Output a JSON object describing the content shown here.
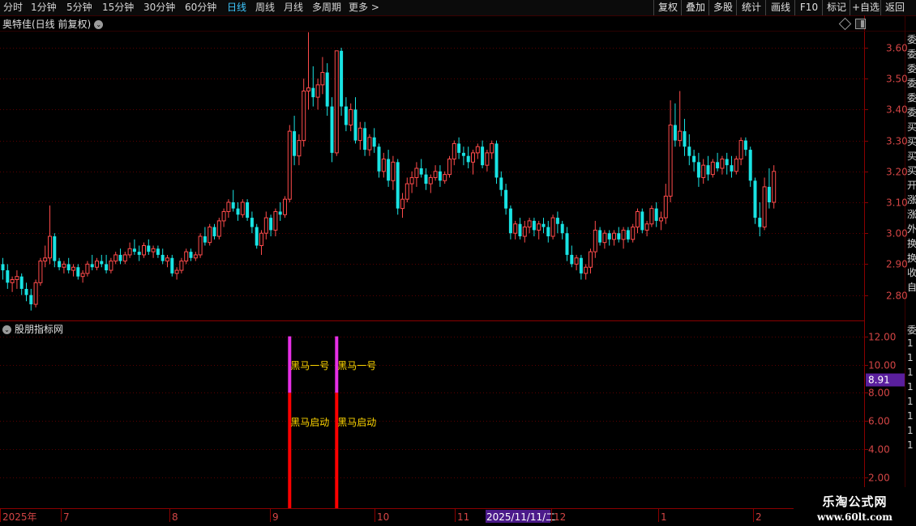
{
  "toolbar": {
    "periods": [
      "分时",
      "1分钟",
      "5分钟",
      "15分钟",
      "30分钟",
      "60分钟",
      "日线",
      "周线",
      "月线",
      "多周期",
      "更多 >"
    ],
    "active_period": "日线",
    "actions": [
      "复权",
      "叠加",
      "多股",
      "统计",
      "画线",
      "F10",
      "标记",
      "+自选",
      "返回"
    ]
  },
  "main_chart": {
    "title": "奥特佳(日线 前复权)",
    "y_ticks": [
      "3.60",
      "3.50",
      "3.40",
      "3.30",
      "3.20",
      "3.10",
      "3.00",
      "2.90",
      "2.80"
    ]
  },
  "indicator": {
    "title": "股朋指标网",
    "y_ticks": [
      "12.00",
      "10.00",
      "8.00",
      "6.00",
      "4.00",
      "2.00"
    ],
    "current_value": "8.91",
    "signal_top_label": "黑马一号",
    "signal_bottom_label": "黑马启动"
  },
  "x_axis": {
    "labels": [
      "2025年",
      "7",
      "8",
      "9",
      "10",
      "11",
      "2025/11/11/二",
      "12",
      "1",
      "2"
    ]
  },
  "watermark": {
    "title": "乐淘公式网",
    "url": "www.60lt.com"
  },
  "right_strip": [
    "委",
    "委",
    "委",
    "委",
    "委",
    "委",
    "买",
    "买",
    "买",
    "买",
    "开",
    "涨",
    "涨",
    "外",
    "换",
    "换",
    "收",
    "自",
    "委",
    "1",
    "1",
    "1",
    "1",
    "1",
    "1",
    "1",
    "1"
  ],
  "colors": {
    "up": "#ff4b4b",
    "down": "#19e3e3",
    "axis_red": "#8a0000",
    "magenta": "#e62fe6",
    "signal_red": "#ff0000",
    "label_yellow": "#ffd700",
    "value_bg": "#5a1f9e",
    "x_highlight_bg": "#4b1a8a"
  },
  "chart_data": {
    "type": "candlestick",
    "ylim": [
      2.73,
      3.68
    ],
    "candles": [
      [
        2.9,
        2.92,
        2.85,
        2.88
      ],
      [
        2.88,
        2.9,
        2.82,
        2.84
      ],
      [
        2.84,
        2.86,
        2.81,
        2.85
      ],
      [
        2.85,
        2.88,
        2.82,
        2.86
      ],
      [
        2.86,
        2.87,
        2.8,
        2.82
      ],
      [
        2.82,
        2.84,
        2.78,
        2.8
      ],
      [
        2.8,
        2.82,
        2.75,
        2.77
      ],
      [
        2.77,
        2.85,
        2.76,
        2.84
      ],
      [
        2.84,
        2.92,
        2.83,
        2.91
      ],
      [
        2.91,
        2.96,
        2.89,
        2.92
      ],
      [
        2.92,
        3.09,
        2.9,
        2.99
      ],
      [
        2.99,
        3.0,
        2.89,
        2.91
      ],
      [
        2.91,
        2.92,
        2.88,
        2.89
      ],
      [
        2.89,
        2.91,
        2.87,
        2.9
      ],
      [
        2.9,
        2.92,
        2.87,
        2.88
      ],
      [
        2.88,
        2.9,
        2.86,
        2.89
      ],
      [
        2.89,
        2.9,
        2.85,
        2.86
      ],
      [
        2.86,
        2.88,
        2.84,
        2.87
      ],
      [
        2.87,
        2.91,
        2.86,
        2.9
      ],
      [
        2.9,
        2.93,
        2.88,
        2.89
      ],
      [
        2.89,
        2.92,
        2.88,
        2.91
      ],
      [
        2.91,
        2.93,
        2.89,
        2.9
      ],
      [
        2.9,
        2.93,
        2.87,
        2.88
      ],
      [
        2.88,
        2.92,
        2.87,
        2.91
      ],
      [
        2.91,
        2.94,
        2.9,
        2.93
      ],
      [
        2.93,
        2.95,
        2.9,
        2.91
      ],
      [
        2.91,
        2.94,
        2.9,
        2.93
      ],
      [
        2.93,
        2.97,
        2.92,
        2.95
      ],
      [
        2.95,
        2.98,
        2.93,
        2.94
      ],
      [
        2.94,
        2.96,
        2.91,
        2.93
      ],
      [
        2.93,
        2.97,
        2.92,
        2.96
      ],
      [
        2.96,
        2.98,
        2.93,
        2.94
      ],
      [
        2.94,
        2.96,
        2.92,
        2.95
      ],
      [
        2.95,
        2.96,
        2.92,
        2.93
      ],
      [
        2.93,
        2.95,
        2.9,
        2.91
      ],
      [
        2.91,
        2.93,
        2.89,
        2.92
      ],
      [
        2.92,
        2.93,
        2.86,
        2.87
      ],
      [
        2.87,
        2.89,
        2.85,
        2.88
      ],
      [
        2.88,
        2.92,
        2.87,
        2.91
      ],
      [
        2.91,
        2.95,
        2.9,
        2.94
      ],
      [
        2.94,
        2.95,
        2.91,
        2.92
      ],
      [
        2.92,
        2.94,
        2.91,
        2.93
      ],
      [
        2.93,
        3.0,
        2.92,
        2.99
      ],
      [
        2.99,
        3.02,
        2.96,
        2.97
      ],
      [
        2.97,
        3.03,
        2.96,
        3.02
      ],
      [
        3.02,
        3.03,
        2.98,
        2.99
      ],
      [
        2.99,
        3.05,
        2.98,
        3.04
      ],
      [
        3.04,
        3.08,
        3.02,
        3.07
      ],
      [
        3.07,
        3.11,
        3.05,
        3.1
      ],
      [
        3.1,
        3.14,
        3.07,
        3.08
      ],
      [
        3.08,
        3.1,
        3.04,
        3.06
      ],
      [
        3.06,
        3.11,
        3.05,
        3.1
      ],
      [
        3.1,
        3.11,
        3.04,
        3.05
      ],
      [
        3.05,
        3.07,
        3.0,
        3.02
      ],
      [
        3.02,
        3.03,
        2.95,
        2.96
      ],
      [
        2.96,
        3.01,
        2.93,
        3.0
      ],
      [
        3.0,
        3.07,
        2.98,
        3.05
      ],
      [
        3.05,
        3.06,
        2.99,
        3.01
      ],
      [
        3.01,
        3.08,
        2.99,
        3.07
      ],
      [
        3.07,
        3.1,
        3.04,
        3.06
      ],
      [
        3.06,
        3.12,
        3.05,
        3.11
      ],
      [
        3.11,
        3.35,
        3.1,
        3.33
      ],
      [
        3.33,
        3.38,
        3.22,
        3.25
      ],
      [
        3.25,
        3.32,
        3.22,
        3.3
      ],
      [
        3.3,
        3.5,
        3.28,
        3.46
      ],
      [
        3.46,
        3.65,
        3.4,
        3.47
      ],
      [
        3.47,
        3.54,
        3.41,
        3.44
      ],
      [
        3.44,
        3.5,
        3.4,
        3.48
      ],
      [
        3.48,
        3.57,
        3.45,
        3.52
      ],
      [
        3.52,
        3.55,
        3.38,
        3.41
      ],
      [
        3.41,
        3.44,
        3.23,
        3.26
      ],
      [
        3.26,
        3.59,
        3.25,
        3.59
      ],
      [
        3.59,
        3.6,
        3.38,
        3.41
      ],
      [
        3.41,
        3.44,
        3.33,
        3.35
      ],
      [
        3.35,
        3.42,
        3.33,
        3.4
      ],
      [
        3.4,
        3.44,
        3.29,
        3.3
      ],
      [
        3.3,
        3.36,
        3.27,
        3.34
      ],
      [
        3.34,
        3.36,
        3.25,
        3.27
      ],
      [
        3.27,
        3.32,
        3.25,
        3.31
      ],
      [
        3.31,
        3.34,
        3.26,
        3.28
      ],
      [
        3.28,
        3.29,
        3.18,
        3.2
      ],
      [
        3.2,
        3.26,
        3.18,
        3.24
      ],
      [
        3.24,
        3.27,
        3.15,
        3.17
      ],
      [
        3.17,
        3.25,
        3.14,
        3.23
      ],
      [
        3.23,
        3.24,
        3.06,
        3.08
      ],
      [
        3.08,
        3.13,
        3.05,
        3.11
      ],
      [
        3.11,
        3.18,
        3.1,
        3.16
      ],
      [
        3.16,
        3.2,
        3.13,
        3.18
      ],
      [
        3.18,
        3.23,
        3.15,
        3.21
      ],
      [
        3.21,
        3.24,
        3.18,
        3.19
      ],
      [
        3.19,
        3.21,
        3.14,
        3.16
      ],
      [
        3.16,
        3.19,
        3.13,
        3.18
      ],
      [
        3.18,
        3.22,
        3.17,
        3.2
      ],
      [
        3.2,
        3.22,
        3.15,
        3.17
      ],
      [
        3.17,
        3.2,
        3.16,
        3.19
      ],
      [
        3.19,
        3.25,
        3.18,
        3.24
      ],
      [
        3.24,
        3.3,
        3.22,
        3.29
      ],
      [
        3.29,
        3.31,
        3.24,
        3.26
      ],
      [
        3.26,
        3.28,
        3.22,
        3.25
      ],
      [
        3.25,
        3.28,
        3.21,
        3.23
      ],
      [
        3.23,
        3.27,
        3.19,
        3.26
      ],
      [
        3.26,
        3.29,
        3.24,
        3.28
      ],
      [
        3.28,
        3.3,
        3.21,
        3.22
      ],
      [
        3.22,
        3.27,
        3.2,
        3.26
      ],
      [
        3.26,
        3.3,
        3.24,
        3.29
      ],
      [
        3.29,
        3.3,
        3.16,
        3.18
      ],
      [
        3.18,
        3.2,
        3.12,
        3.14
      ],
      [
        3.14,
        3.16,
        3.06,
        3.08
      ],
      [
        3.08,
        3.09,
        2.98,
        3.0
      ],
      [
        3.0,
        3.04,
        2.98,
        3.03
      ],
      [
        3.03,
        3.05,
        2.98,
        2.99
      ],
      [
        2.99,
        3.04,
        2.97,
        3.02
      ],
      [
        3.02,
        3.05,
        3.0,
        3.04
      ],
      [
        3.04,
        3.05,
        2.99,
        3.01
      ],
      [
        3.01,
        3.04,
        2.98,
        3.03
      ],
      [
        3.03,
        3.05,
        3.0,
        3.02
      ],
      [
        3.02,
        3.04,
        2.97,
        2.99
      ],
      [
        2.99,
        3.06,
        2.98,
        3.05
      ],
      [
        3.05,
        3.07,
        3.0,
        3.03
      ],
      [
        3.03,
        3.04,
        2.98,
        3.0
      ],
      [
        3.0,
        3.02,
        2.91,
        2.93
      ],
      [
        2.93,
        2.96,
        2.89,
        2.9
      ],
      [
        2.9,
        2.93,
        2.88,
        2.92
      ],
      [
        2.92,
        2.93,
        2.85,
        2.87
      ],
      [
        2.87,
        2.9,
        2.85,
        2.89
      ],
      [
        2.89,
        2.95,
        2.87,
        2.94
      ],
      [
        2.94,
        3.04,
        2.92,
        3.01
      ],
      [
        3.01,
        3.02,
        2.96,
        2.97
      ],
      [
        2.97,
        3.01,
        2.95,
        3.0
      ],
      [
        3.0,
        3.01,
        2.96,
        2.98
      ],
      [
        2.98,
        3.01,
        2.96,
        3.0
      ],
      [
        3.0,
        3.02,
        2.97,
        2.98
      ],
      [
        2.98,
        3.02,
        2.95,
        3.01
      ],
      [
        3.01,
        3.02,
        2.97,
        2.98
      ],
      [
        2.98,
        3.03,
        2.97,
        3.02
      ],
      [
        3.02,
        3.08,
        3.0,
        3.07
      ],
      [
        3.07,
        3.08,
        3.0,
        3.01
      ],
      [
        3.01,
        3.04,
        2.99,
        3.03
      ],
      [
        3.03,
        3.09,
        3.02,
        3.08
      ],
      [
        3.08,
        3.1,
        3.02,
        3.04
      ],
      [
        3.04,
        3.07,
        3.01,
        3.05
      ],
      [
        3.05,
        3.16,
        3.03,
        3.12
      ],
      [
        3.12,
        3.43,
        3.1,
        3.35
      ],
      [
        3.35,
        3.42,
        3.28,
        3.3
      ],
      [
        3.3,
        3.46,
        3.28,
        3.33
      ],
      [
        3.33,
        3.37,
        3.25,
        3.28
      ],
      [
        3.28,
        3.32,
        3.22,
        3.25
      ],
      [
        3.25,
        3.27,
        3.2,
        3.23
      ],
      [
        3.23,
        3.26,
        3.15,
        3.18
      ],
      [
        3.18,
        3.24,
        3.16,
        3.22
      ],
      [
        3.22,
        3.25,
        3.17,
        3.19
      ],
      [
        3.19,
        3.24,
        3.18,
        3.23
      ],
      [
        3.23,
        3.26,
        3.2,
        3.21
      ],
      [
        3.21,
        3.25,
        3.19,
        3.24
      ],
      [
        3.24,
        3.26,
        3.19,
        3.22
      ],
      [
        3.22,
        3.25,
        3.18,
        3.2
      ],
      [
        3.2,
        3.25,
        3.19,
        3.24
      ],
      [
        3.24,
        3.31,
        3.22,
        3.3
      ],
      [
        3.3,
        3.31,
        3.25,
        3.27
      ],
      [
        3.27,
        3.28,
        3.15,
        3.17
      ],
      [
        3.17,
        3.18,
        3.03,
        3.05
      ],
      [
        3.05,
        3.1,
        2.99,
        3.02
      ],
      [
        3.02,
        3.18,
        3.01,
        3.15
      ],
      [
        3.15,
        3.21,
        3.08,
        3.1
      ],
      [
        3.1,
        3.22,
        3.08,
        3.2
      ]
    ],
    "signals": [
      {
        "candle_index": 61,
        "value": 12.0,
        "split_value": 8.0
      },
      {
        "candle_index": 71,
        "value": 12.0,
        "split_value": 8.0
      }
    ],
    "indicator_ylim": [
      0,
      12.9
    ]
  }
}
